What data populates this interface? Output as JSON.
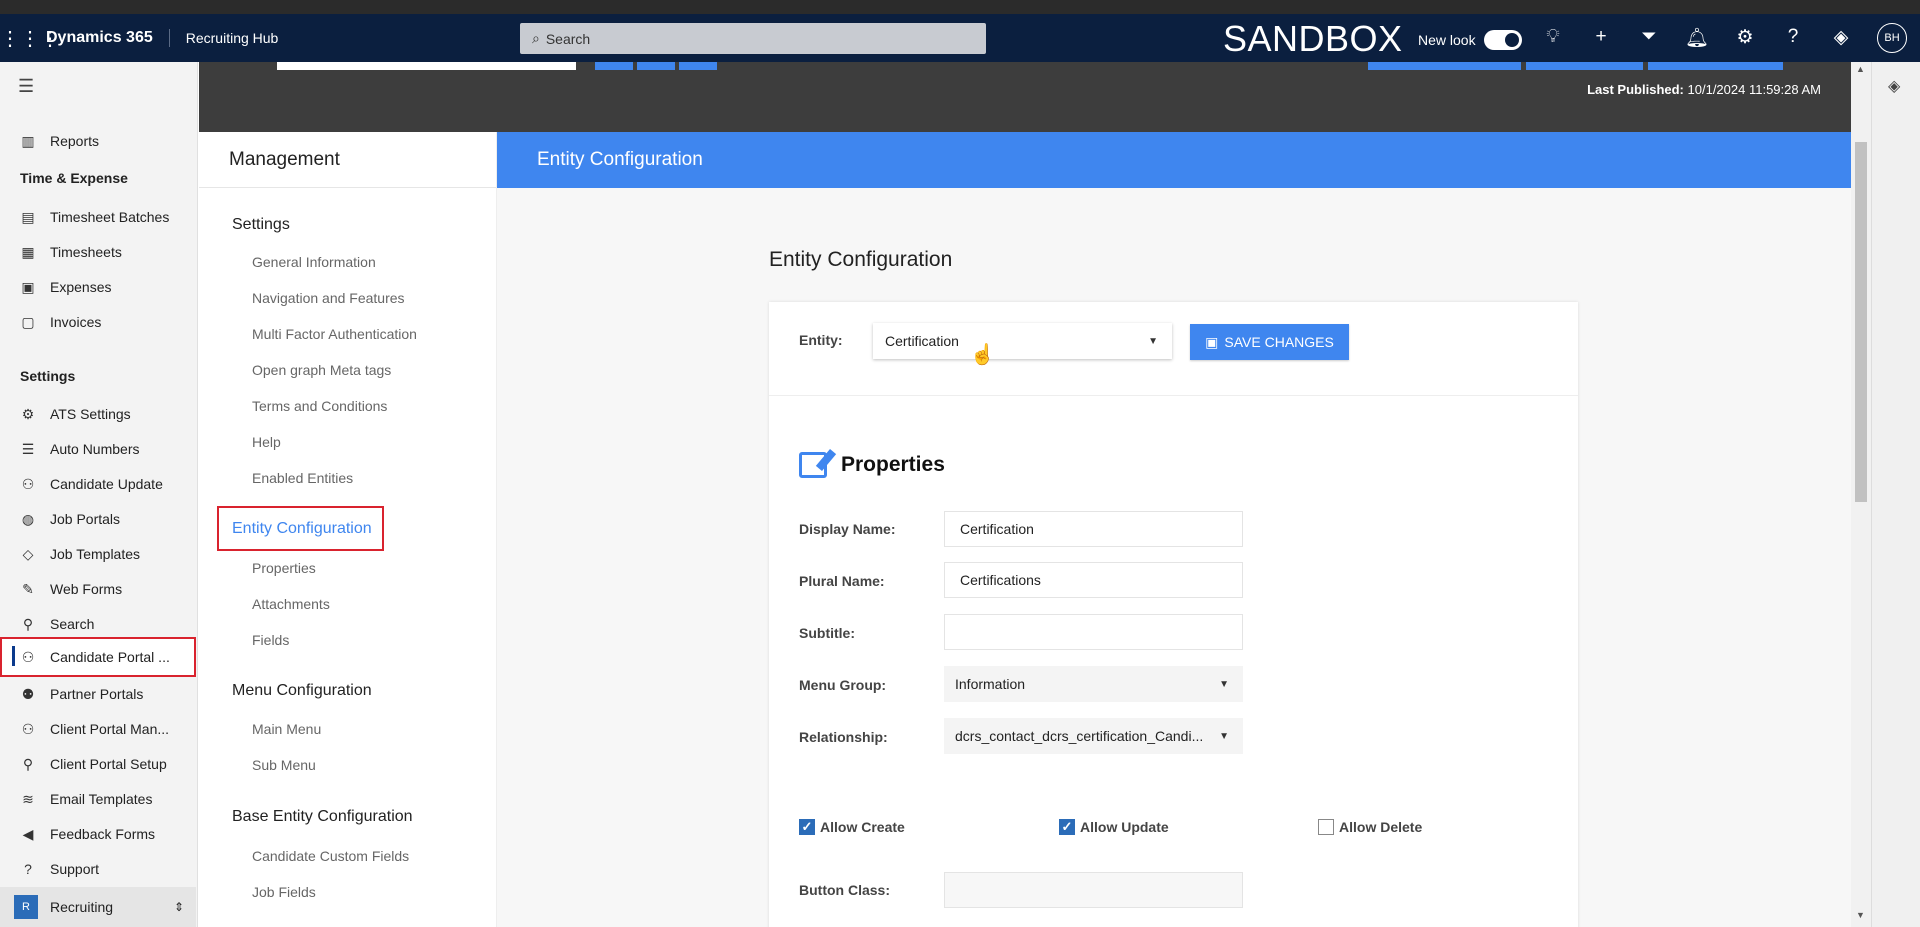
{
  "topbar": {
    "brand": "Dynamics 365",
    "app_name": "Recruiting Hub",
    "search_placeholder": "Search",
    "environment": "SANDBOX",
    "new_look_label": "New look",
    "new_look_on": true,
    "icons": [
      "lightbulb-icon",
      "plus-icon",
      "filter-icon",
      "bell-icon",
      "gear-icon",
      "help-icon",
      "copilot-icon"
    ],
    "avatar_initials": "BH"
  },
  "leftnav": {
    "items_top": [
      {
        "label": "Reports",
        "icon": "report-icon"
      }
    ],
    "sections": [
      {
        "title": "Time & Expense",
        "items": [
          {
            "label": "Timesheet Batches",
            "icon": "batches-icon"
          },
          {
            "label": "Timesheets",
            "icon": "timesheet-icon"
          },
          {
            "label": "Expenses",
            "icon": "expenses-icon"
          },
          {
            "label": "Invoices",
            "icon": "invoice-icon"
          }
        ]
      },
      {
        "title": "Settings",
        "items": [
          {
            "label": "ATS Settings",
            "icon": "gear-icon"
          },
          {
            "label": "Auto Numbers",
            "icon": "numbered-list-icon"
          },
          {
            "label": "Candidate Update",
            "icon": "people-icon"
          },
          {
            "label": "Job Portals",
            "icon": "globe-icon"
          },
          {
            "label": "Job Templates",
            "icon": "template-icon"
          },
          {
            "label": "Web Forms",
            "icon": "form-icon"
          },
          {
            "label": "Search",
            "icon": "search-icon"
          },
          {
            "label": "Candidate Portal ...",
            "icon": "people-icon",
            "selected": true
          },
          {
            "label": "Partner Portals",
            "icon": "partners-icon"
          },
          {
            "label": "Client Portal Man...",
            "icon": "people-icon"
          },
          {
            "label": "Client Portal Setup",
            "icon": "person-icon"
          },
          {
            "label": "Email Templates",
            "icon": "layers-icon"
          },
          {
            "label": "Feedback Forms",
            "icon": "megaphone-icon"
          },
          {
            "label": "Support",
            "icon": "help-circle-icon"
          }
        ]
      }
    ],
    "area_badge": "R",
    "area_label": "Recruiting"
  },
  "header_band": {
    "last_published_label": "Last Published:",
    "last_published_value": "10/1/2024 11:59:28 AM"
  },
  "management": {
    "title": "Management",
    "groups": [
      {
        "title": "Settings",
        "items": [
          "General Information",
          "Navigation and Features",
          "Multi Factor Authentication",
          "Open graph Meta tags",
          "Terms and Conditions",
          "Help",
          "Enabled Entities"
        ]
      },
      {
        "title": "Entity Configuration",
        "active": true,
        "items": [
          "Properties",
          "Attachments",
          "Fields"
        ]
      },
      {
        "title": "Menu Configuration",
        "items": [
          "Main Menu",
          "Sub Menu"
        ]
      },
      {
        "title": "Base Entity Configuration",
        "items": [
          "Candidate Custom Fields",
          "Job Fields"
        ]
      }
    ]
  },
  "entity_config": {
    "banner_title": "Entity Configuration",
    "page_title": "Entity Configuration",
    "entity_label": "Entity:",
    "entity_value": "Certification",
    "save_button": "SAVE CHANGES",
    "properties_title": "Properties",
    "fields": {
      "display_name_label": "Display Name:",
      "display_name_value": "Certification",
      "plural_name_label": "Plural Name:",
      "plural_name_value": "Certifications",
      "subtitle_label": "Subtitle:",
      "subtitle_value": "",
      "menu_group_label": "Menu Group:",
      "menu_group_value": "Information",
      "relationship_label": "Relationship:",
      "relationship_value": "dcrs_contact_dcrs_certification_Candi...",
      "button_class_label": "Button Class:",
      "button_class_value": ""
    },
    "checkboxes": [
      {
        "label": "Allow Create",
        "checked": true
      },
      {
        "label": "Allow Update",
        "checked": true
      },
      {
        "label": "Allow Delete",
        "checked": false
      }
    ]
  }
}
